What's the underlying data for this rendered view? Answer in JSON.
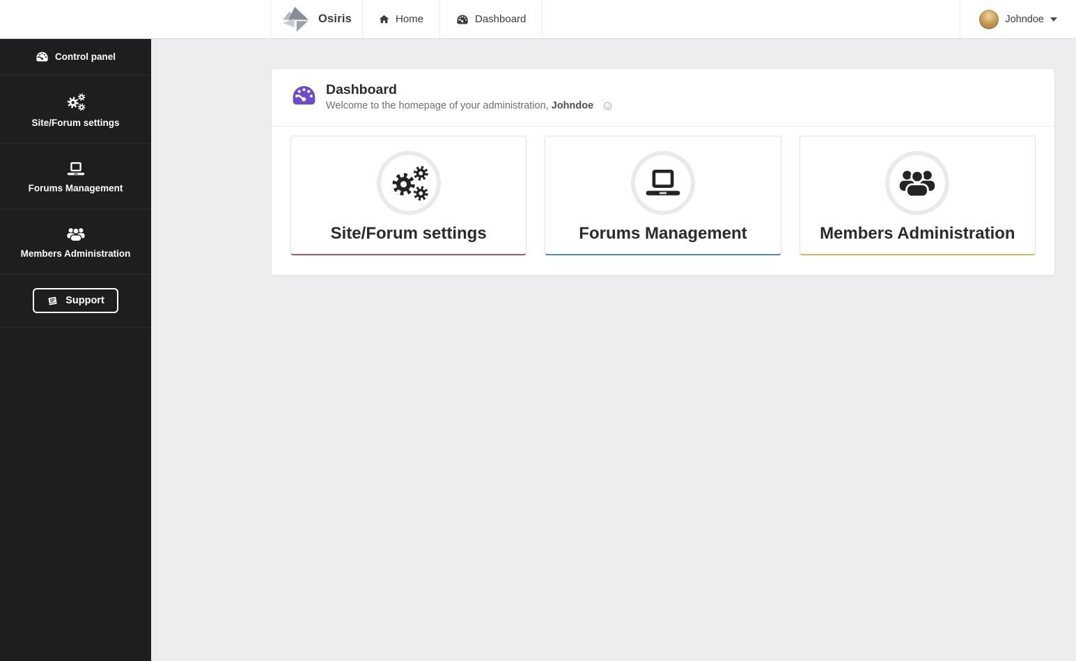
{
  "navbar": {
    "brand": "Osiris",
    "items": [
      {
        "label": "Home",
        "icon": "home-icon"
      },
      {
        "label": "Dashboard",
        "icon": "dashboard-icon"
      }
    ],
    "user": {
      "name": "Johndoe",
      "icon": "caret-down-icon"
    }
  },
  "sidebar": {
    "header": {
      "label": "Control panel",
      "icon": "dashboard-icon"
    },
    "items": [
      {
        "label": "Site/Forum settings",
        "icon": "gears-icon"
      },
      {
        "label": "Forums Management",
        "icon": "laptop-icon"
      },
      {
        "label": "Members Administration",
        "icon": "users-icon"
      }
    ],
    "support": {
      "label": "Support",
      "icon": "book-icon"
    }
  },
  "main": {
    "header": {
      "icon": "dashboard-icon",
      "title": "Dashboard",
      "subtitle_prefix": "Welcome to the homepage of your administration,",
      "subtitle_user": "Johndoe",
      "subtitle_emoticon": "smiley-icon"
    },
    "cards": [
      {
        "label": "Site/Forum settings",
        "icon": "gears-icon",
        "accent_color": "#b2595f"
      },
      {
        "label": "Forums Management",
        "icon": "laptop-icon",
        "accent_color": "#4a90bc"
      },
      {
        "label": "Members Administration",
        "icon": "users-icon",
        "accent_color": "#d3b662"
      }
    ]
  },
  "colors": {
    "navbar_bg": "#ffffff",
    "sidebar_bg": "#1d1e20",
    "content_bg": "#ecedee",
    "panel_bg": "#ffffff",
    "header_icon_purple": "#6a4bcb",
    "accent_red": "#b2595f",
    "accent_blue": "#4a90bc",
    "accent_gold": "#d3b662"
  }
}
